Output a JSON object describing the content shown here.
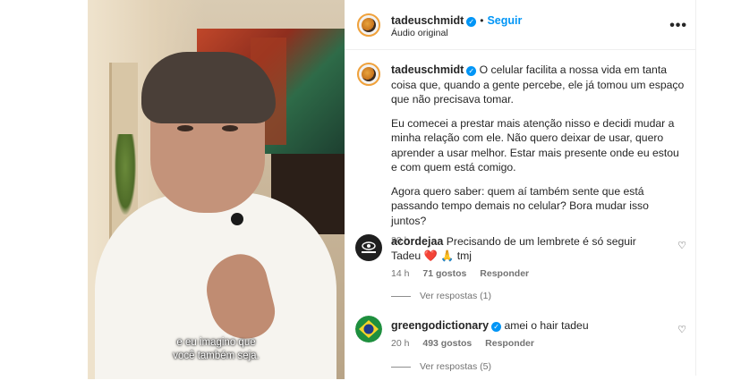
{
  "video": {
    "caption_line1": "e eu imagino que",
    "caption_line2": "você também seja."
  },
  "header": {
    "username": "tadeuschmidt",
    "separator": "•",
    "follow_label": "Seguir",
    "audio": "Áudio original",
    "more_icon": "more-horizontal-icon"
  },
  "post": {
    "username": "tadeuschmidt",
    "paragraphs": [
      "O celular facilita a nossa vida em tanta coisa que, quando a gente percebe, ele já tomou um espaço que não precisava tomar.",
      "Eu comecei a prestar mais atenção nisso e decidi mudar a minha relação com ele. Não quero deixar de usar, quero aprender a usar melhor. Estar mais presente onde eu estou e com quem está comigo.",
      "Agora quero saber: quem aí também sente que está passando tempo demais no celular? Bora mudar isso juntos?"
    ],
    "time": "20 h"
  },
  "comments": [
    {
      "username": "acordejaa",
      "text": "Precisando de um lembrete é só seguir Tadeu ❤️ 🙏 tmj",
      "time": "14 h",
      "likes": "71 gostos",
      "reply": "Responder",
      "view_replies": "Ver respostas (1)",
      "avatar_text": "ACORDEJAA"
    },
    {
      "username": "greengodictionary",
      "text": "amei o hair tadeu",
      "time": "20 h",
      "likes": "493 gostos",
      "reply": "Responder",
      "view_replies": "Ver respostas (5)"
    }
  ],
  "colors": {
    "accent": "#0095f6",
    "text": "#262626",
    "secondary": "#737373"
  }
}
